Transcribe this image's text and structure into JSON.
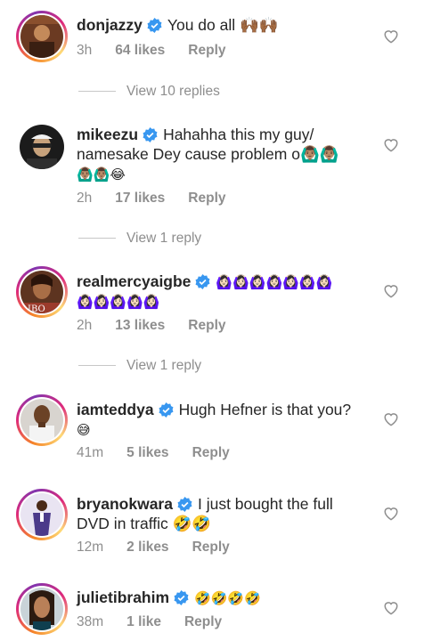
{
  "comments": [
    {
      "username": "donjazzy",
      "text": "You do all 🙌🏾🙌🏾",
      "time": "3h",
      "likes": "64 likes",
      "reply": "Reply",
      "view_replies": "View 10 replies"
    },
    {
      "username": "mikeezu",
      "text_line1": "Hahahha this my guy/",
      "text_line2": "namesake Dey cause problem o🙆🏽‍♂️🙆🏽‍♂️",
      "text_line3": "🙆🏽‍♂️🙆🏽‍♂️😂",
      "time": "2h",
      "likes": "17 likes",
      "reply": "Reply",
      "view_replies": "View 1 reply"
    },
    {
      "username": "realmercyaigbe",
      "text_line1": "🙆🏻‍♀️🙆🏻‍♀️🙆🏻‍♀️🙆🏻‍♀️🙆🏻‍♀️🙆🏻‍♀️🙆🏻‍♀️",
      "text_line2": "🙆🏻‍♀️🙆🏻‍♀️🙆🏻‍♀️🙆🏻‍♀️🙆🏻‍♀️",
      "time": "2h",
      "likes": "13 likes",
      "reply": "Reply",
      "view_replies": "View 1 reply"
    },
    {
      "username": "iamteddya",
      "text_line1": "Hugh Hefner is that you?",
      "text_line2": "😅",
      "time": "41m",
      "likes": "5 likes",
      "reply": "Reply"
    },
    {
      "username": "bryanokwara",
      "text_line1": "I just bought the full",
      "text_line2": "DVD in traffic 🤣🤣",
      "time": "12m",
      "likes": "2 likes",
      "reply": "Reply"
    },
    {
      "username": "julietibrahim",
      "text": "🤣🤣🤣🤣",
      "time": "38m",
      "likes": "1 like",
      "reply": "Reply"
    }
  ],
  "colors": {
    "text": "#262626",
    "muted": "#8e8e8e",
    "verified": "#3897f0",
    "ring_start": "#f58529",
    "ring_end": "#8134af"
  },
  "icons": {
    "verified": "verified-badge-icon",
    "like": "heart-outline-icon"
  }
}
